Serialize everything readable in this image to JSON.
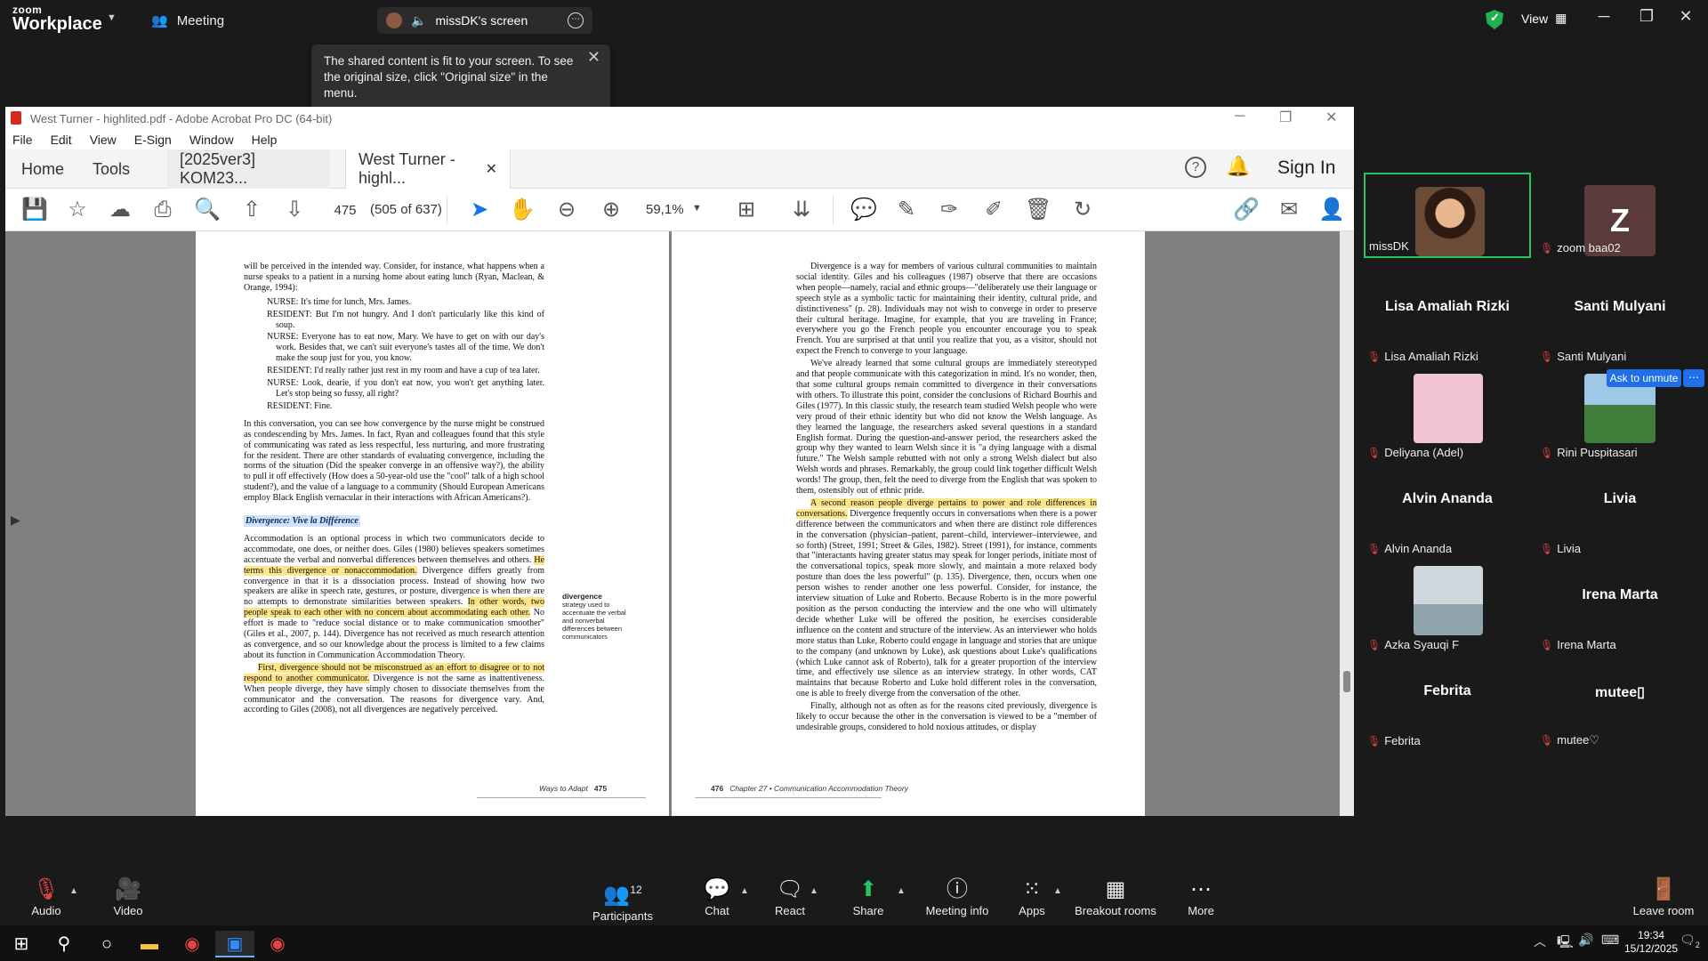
{
  "zoom": {
    "brand_line1": "zoom",
    "brand_line2": "Workplace",
    "meeting_label": "Meeting",
    "share_label": "missDK's screen",
    "view_label": "View",
    "tooltip": "The shared content is fit to your screen. To see the original size, click \"Original size\" in the menu."
  },
  "acrobat": {
    "title": "West Turner - highlited.pdf - Adobe Acrobat Pro DC (64-bit)",
    "menu": [
      "File",
      "Edit",
      "View",
      "E-Sign",
      "Window",
      "Help"
    ],
    "tabs": {
      "home": "Home",
      "tools": "Tools",
      "doc1": "[2025ver3] KOM23...",
      "doc2": "West Turner - highl..."
    },
    "sign_in": "Sign In",
    "page_number": "475",
    "page_total": "(505 of 637)",
    "zoom_level": "59,1%"
  },
  "left_page": {
    "intro": "will be perceived in the intended way. Consider, for instance, what happens when a nurse speaks to a patient in a nursing home about eating lunch (Ryan, Maclean, & Orange, 1994):",
    "dialogue": [
      "NURSE: It's time for lunch, Mrs. James.",
      "RESIDENT: But I'm not hungry. And I don't particularly like this kind of soup.",
      "NURSE: Everyone has to eat now, Mary. We have to get on with our day's work. Besides that, we can't suit everyone's tastes all of the time. We don't make the soup just for you, you know.",
      "RESIDENT: I'd really rather just rest in my room and have a cup of tea later.",
      "NURSE: Look, dearie, if you don't eat now, you won't get anything later. Let's stop being so fussy, all right?",
      "RESIDENT: Fine."
    ],
    "para1": "In this conversation, you can see how convergence by the nurse might be construed as condescending by Mrs. James. In fact, Ryan and colleagues found that this style of communicating was rated as less respectful, less nurturing, and more frustrating for the resident. There are other standards of evaluating convergence, including the norms of the situation (Did the speaker converge in an offensive way?), the ability to pull it off effectively (How does a 50-year-old use the \"cool\" talk of a high school student?), and the value of a language to a community (Should European Americans employ Black English vernacular in their interactions with African Americans?).",
    "heading": "Divergence: Vive la Différence",
    "para2_a": "Accommodation is an optional process in which two communicators decide to accommodate, one does, or neither does. Giles (1980) believes speakers sometimes accentuate the verbal and nonverbal differences between themselves and others. ",
    "para2_hl1": "He terms this divergence or nonaccommodation.",
    "para2_b": " Divergence differs greatly from convergence in that it is a dissociation process. Instead of showing how two speakers are alike in speech rate, gestures, or posture, divergence is when there are no attempts to demonstrate similarities between speakers. ",
    "para2_hl2": "In other words, two people speak to each other with no concern about accommodating each other.",
    "para2_c": " No effort is made to \"reduce social distance or to make communication smoother\" (Giles et al., 2007, p. 144). Divergence has not received as much research attention as convergence, and so our knowledge about the process is limited to a few claims about its function in Communication Accommodation Theory.",
    "para3_hl": "First, divergence should not be misconstrued as an effort to disagree or to not respond to another communicator.",
    "para3_b": " Divergence is not the same as inattentiveness. When people diverge, they have simply chosen to dissociate themselves from the communicator and the conversation. The reasons for divergence vary. And, according to Giles (2008), not all divergences are negatively perceived.",
    "margin_term": "divergence",
    "margin_def": "strategy used to accentuate the verbal and nonverbal differences between communicators",
    "footer_text": "Ways to Adapt",
    "footer_num": "475"
  },
  "right_page": {
    "para1": "Divergence is a way for members of various cultural communities to maintain social identity. Giles and his colleagues (1987) observe that there are occasions when people—namely, racial and ethnic groups—\"deliberately use their language or speech style as a symbolic tactic for maintaining their identity, cultural pride, and distinctiveness\" (p. 28). Individuals may not wish to converge in order to preserve their cultural heritage. Imagine, for example, that you are traveling in France; everywhere you go the French people you encounter encourage you to speak French. You are surprised at that until you realize that you, as a visitor, should not expect the French to converge to your language.",
    "para2": "We've already learned that some cultural groups are immediately stereotyped and that people communicate with this categorization in mind. It's no wonder, then, that some cultural groups remain committed to divergence in their conversations with others. To illustrate this point, consider the conclusions of Richard Bourhis and Giles (1977). In this classic study, the research team studied Welsh people who were very proud of their ethnic identity but who did not know the Welsh language. As they learned the language, the researchers asked several questions in a standard English format. During the question-and-answer period, the researchers asked the group why they wanted to learn Welsh since it is \"a dying language with a dismal future.\" The Welsh sample rebutted with not only a strong Welsh dialect but also Welsh words and phrases. Remarkably, the group could link together difficult Welsh words! The group, then, felt the need to diverge from the English that was spoken to them, ostensibly out of ethnic pride.",
    "para3_hl": "A second reason people diverge pertains to power and role differences in conversations.",
    "para3_b": " Divergence frequently occurs in conversations when there is a power difference between the communicators and when there are distinct role differences in the conversation (physician–patient, parent–child, interviewer–interviewee, and so forth) (Street, 1991; Street & Giles, 1982). Street (1991), for instance, comments that \"interactants having greater status may speak for longer periods, initiate most of the conversational topics, speak more slowly, and maintain a more relaxed body posture than does the less powerful\" (p. 135). Divergence, then, occurs when one person wishes to render another one less powerful. Consider, for instance, the interview situation of Luke and Roberto. Because Roberto is in the more powerful position as the person conducting the interview and the one who will ultimately decide whether Luke will be offered the position, he exercises considerable influence on the content and structure of the interview. As an interviewer who holds more status than Luke, Roberto could engage in language and stories that are unique to the company (and unknown by Luke), ask questions about Luke's qualifications (which Luke cannot ask of Roberto), talk for a greater proportion of the interview time, and effectively use silence as an interview strategy. In other words, CAT maintains that because Roberto and Luke hold different roles in the conversation, one is able to freely diverge from the conversation of the other.",
    "para4": "Finally, although not as often as for the reasons cited previously, divergence is likely to occur because the other in the conversation is viewed to be a \"member of undesirable groups, considered to hold noxious attitudes, or display",
    "footer_num": "476",
    "footer_text": "Chapter 27 • Communication Accommodation Theory"
  },
  "participants": [
    {
      "label": "missDK",
      "big": "",
      "pic": "photo"
    },
    {
      "label": "zoom baa02",
      "big": "",
      "pic": "letter",
      "letter": "Z"
    },
    {
      "label": "Lisa Amaliah Rizki",
      "big": "Lisa Amaliah Rizki",
      "pic": "none"
    },
    {
      "label": "Santi Mulyani",
      "big": "Santi Mulyani",
      "pic": "none"
    },
    {
      "label": "Deliyana (Adel)",
      "big": "",
      "pic": "pink"
    },
    {
      "label": "Rini Puspitasari",
      "big": "",
      "pic": "landscape"
    },
    {
      "label": "Alvin Ananda",
      "big": "Alvin Ananda",
      "pic": "none"
    },
    {
      "label": "Livia",
      "big": "Livia",
      "pic": "none"
    },
    {
      "label": "Azka Syauqi F",
      "big": "",
      "pic": "beach"
    },
    {
      "label": "Irena Marta",
      "big": "Irena Marta",
      "pic": "none"
    },
    {
      "label": "Febrita",
      "big": "Febrita",
      "pic": "none"
    },
    {
      "label": "mutee♡",
      "big": "mutee▯",
      "pic": "none"
    }
  ],
  "ask_unmute": "Ask to unmute",
  "toolbar": {
    "audio": "Audio",
    "video": "Video",
    "participants": "Participants",
    "participants_count": "12",
    "chat": "Chat",
    "react": "React",
    "share": "Share",
    "meeting_info": "Meeting info",
    "apps": "Apps",
    "breakout": "Breakout rooms",
    "more": "More",
    "leave": "Leave room"
  },
  "taskbar": {
    "time": "19:34",
    "date": "15/12/2025",
    "notif_count": "2"
  }
}
